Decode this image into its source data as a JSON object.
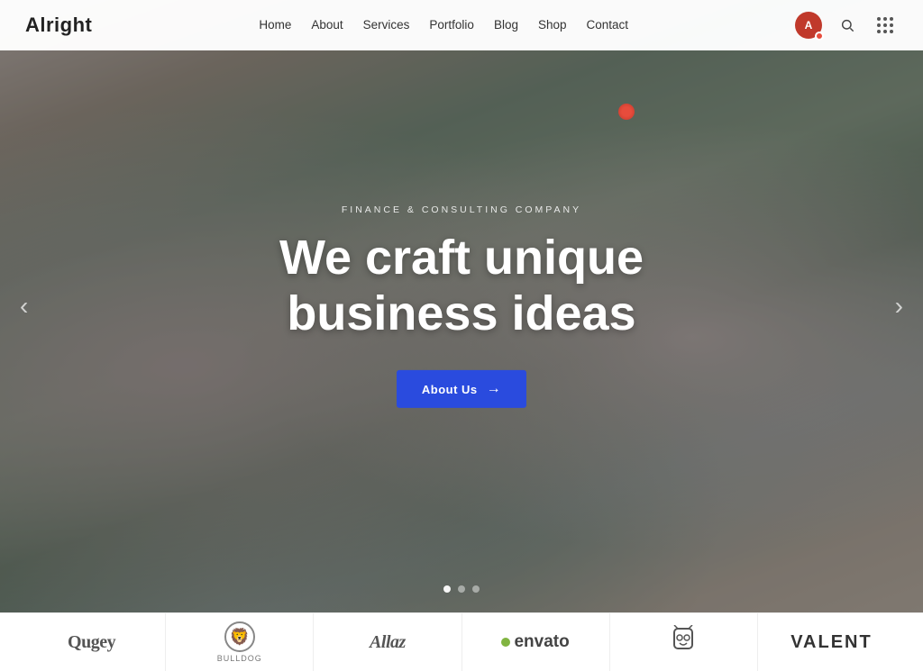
{
  "navbar": {
    "logo": "Alright",
    "links": [
      {
        "label": "Home",
        "href": "#"
      },
      {
        "label": "About",
        "href": "#"
      },
      {
        "label": "Services",
        "href": "#"
      },
      {
        "label": "Portfolio",
        "href": "#"
      },
      {
        "label": "Blog",
        "href": "#"
      },
      {
        "label": "Shop",
        "href": "#"
      },
      {
        "label": "Contact",
        "href": "#"
      }
    ]
  },
  "hero": {
    "subtitle": "Finance & Consulting Company",
    "title_line1": "We craft unique",
    "title_line2": "business ideas",
    "cta_label": "About Us",
    "arrow_right": "→",
    "prev_arrow": "‹",
    "next_arrow": "›",
    "dots": [
      {
        "active": true
      },
      {
        "active": false
      },
      {
        "active": false
      }
    ]
  },
  "logos": [
    {
      "type": "text",
      "value": "Qugey"
    },
    {
      "type": "icon",
      "value": "🦁",
      "sub": "BULLDOG"
    },
    {
      "type": "text",
      "value": "Allaz"
    },
    {
      "type": "envato",
      "value": "envato"
    },
    {
      "type": "owl",
      "value": "🦉"
    },
    {
      "type": "text",
      "value": "VALENT"
    }
  ]
}
